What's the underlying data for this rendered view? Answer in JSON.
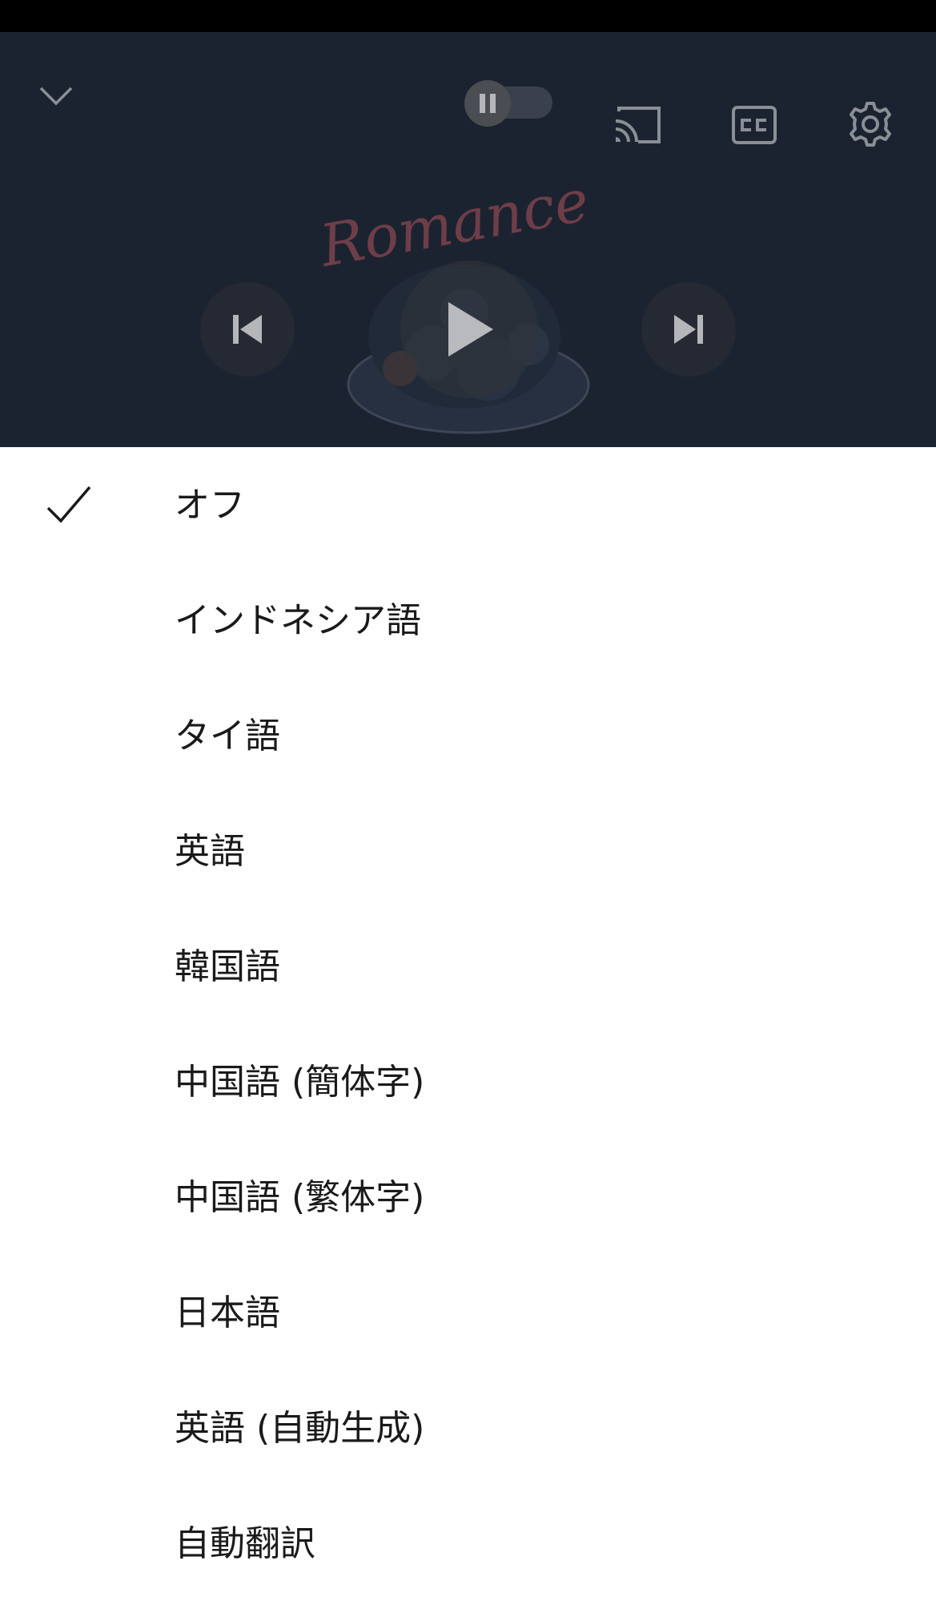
{
  "player": {
    "artwork_text": "Romance",
    "icons": {
      "collapse": "chevron-down-icon",
      "autoplay": "pause-icon",
      "cast": "cast-icon",
      "captions": "closed-captions-icon",
      "settings": "gear-icon",
      "previous": "skip-previous-icon",
      "play": "play-icon",
      "next": "skip-next-icon"
    }
  },
  "caption_menu": {
    "selected_index": 0,
    "items": [
      {
        "label": "オフ"
      },
      {
        "label": "インドネシア語"
      },
      {
        "label": "タイ語"
      },
      {
        "label": "英語"
      },
      {
        "label": "韓国語"
      },
      {
        "label": "中国語 (簡体字)"
      },
      {
        "label": "中国語 (繁体字)"
      },
      {
        "label": "日本語"
      },
      {
        "label": "英語 (自動生成)"
      },
      {
        "label": "自動翻訳"
      }
    ]
  }
}
